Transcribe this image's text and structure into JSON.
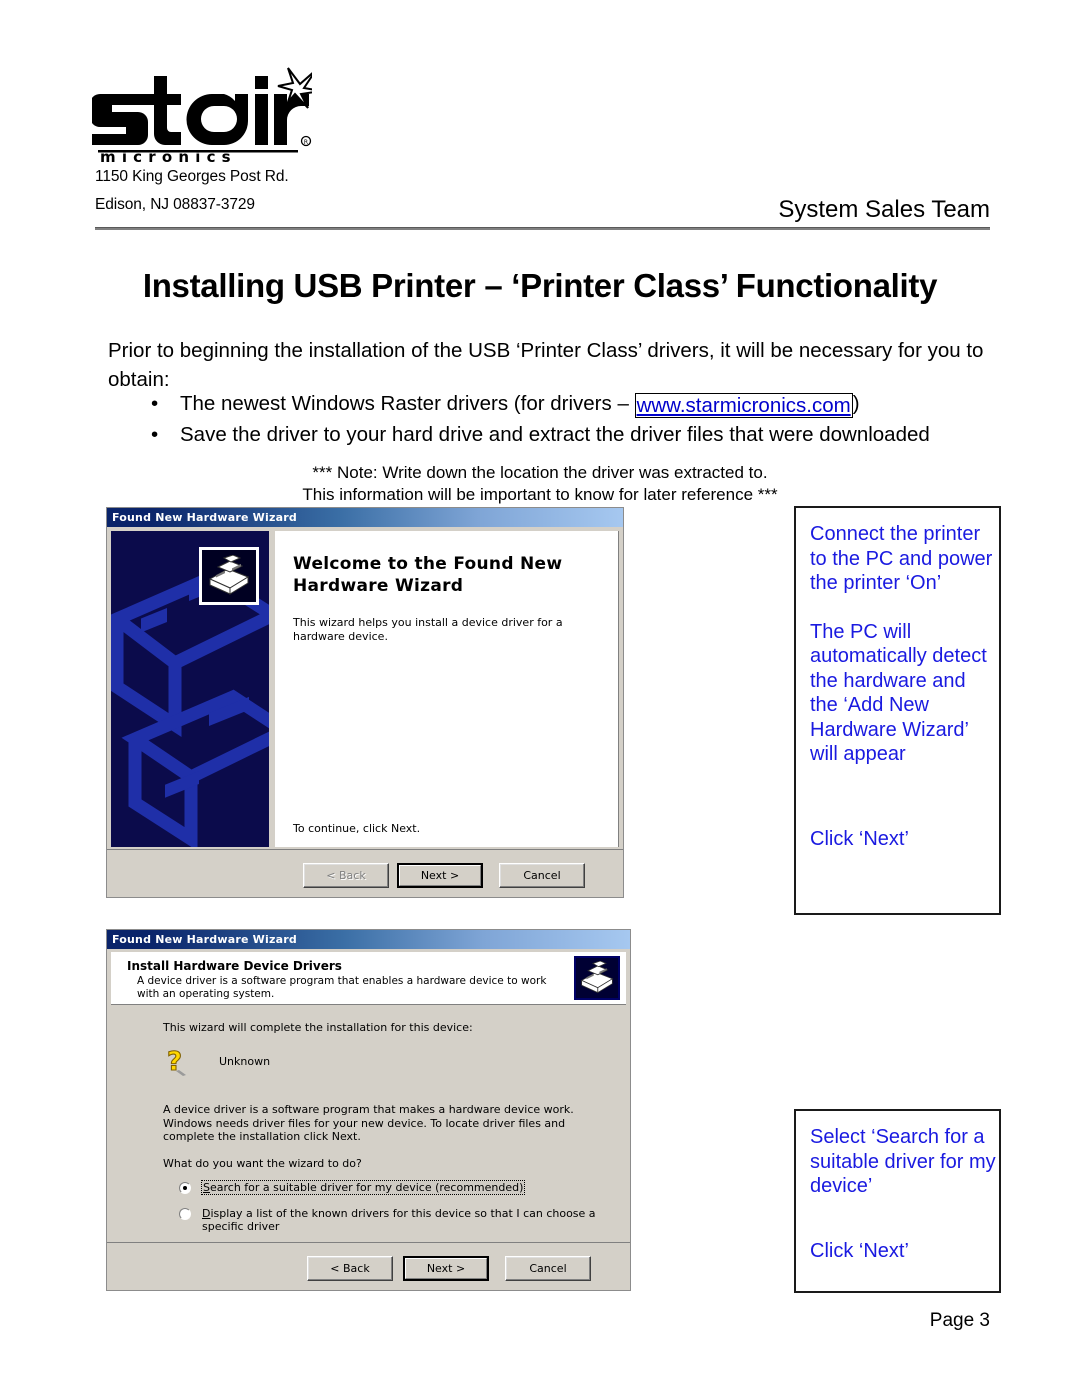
{
  "header": {
    "logo_wordmark": "star",
    "logo_subtext": "m i c r o n i c s",
    "address_line_1": "1150 King Georges Post Rd.",
    "address_line_2": "Edison, NJ 08837-3729",
    "team_label": "System Sales Team"
  },
  "title": "Installing USB Printer – ‘Printer Class’ Functionality",
  "intro": {
    "paragraph": "Prior to beginning the installation of the USB ‘Printer Class’ drivers, it will be necessary for you to obtain:",
    "bullets": [
      {
        "text_before": "The newest Windows Raster drivers (for drivers – ",
        "link": "www.starmicronics.com",
        "text_after": ")"
      },
      {
        "text_before": "Save the driver to your hard drive and extract the driver files that were downloaded",
        "link": "",
        "text_after": ""
      }
    ]
  },
  "note": {
    "line_1": "*** Note:  Write down the location the driver was extracted to.",
    "line_2": "This information will be important to know for later reference ***"
  },
  "dialog_welcome": {
    "titlebar": "Found New Hardware Wizard",
    "heading": "Welcome to the Found New Hardware Wizard",
    "description": "This wizard helps you install a device driver for a hardware device.",
    "continue_text": "To continue, click Next.",
    "buttons": {
      "back": "< Back",
      "next": "Next >",
      "cancel": "Cancel"
    }
  },
  "dialog_install": {
    "titlebar": "Found New Hardware Wizard",
    "header_title": "Install Hardware Device Drivers",
    "header_subtitle": "A device driver is a software program that enables a hardware device to work with an operating system.",
    "line_1": "This wizard will complete the installation for this device:",
    "device_name": "Unknown",
    "paragraph": "A device driver is a software program that makes a hardware device work. Windows needs driver files for your new device. To locate driver files and complete the installation click Next.",
    "question": "What do you want the wizard to do?",
    "options": [
      {
        "accesskey": "S",
        "label_rest": "earch for a suitable driver for my device (recommended)",
        "selected": true
      },
      {
        "accesskey": "D",
        "label_rest": "isplay a list of the known drivers for this device so that I can choose a specific driver",
        "selected": false
      }
    ],
    "buttons": {
      "back": "< Back",
      "next": "Next >",
      "cancel": "Cancel"
    }
  },
  "callouts": {
    "connect": {
      "block_1": "Connect the printer to the PC and power the printer ‘On’",
      "block_2": "The PC will automatically detect the hardware and the ‘Add New Hardware Wizard’ will appear",
      "block_3": "Click ‘Next’"
    },
    "select": {
      "block_1": "Select ‘Search for a suitable driver for my device’",
      "block_2": "Click ‘Next’"
    }
  },
  "footer": {
    "page_label": "Page 3"
  },
  "colors": {
    "link_blue": "#0000cc",
    "callout_blue": "#1a1ae0",
    "titlebar_navy": "#0a246a",
    "dialog_face": "#d4d0c8",
    "sidebar_navy": "#0b0b4b"
  }
}
